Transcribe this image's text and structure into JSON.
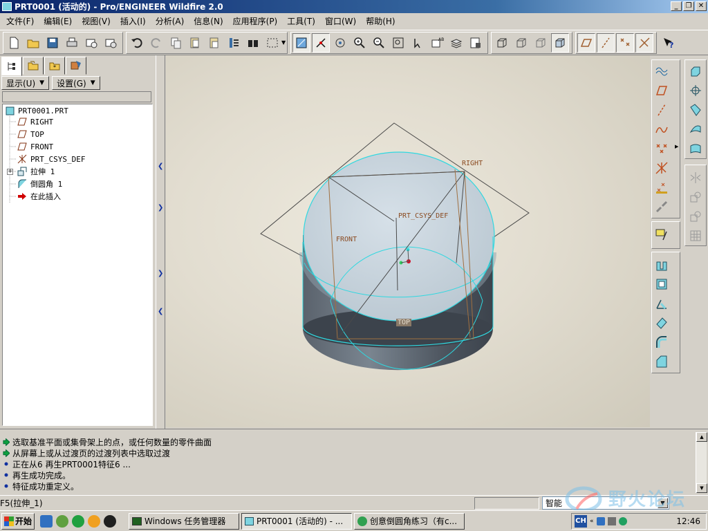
{
  "window": {
    "title": "PRT0001 (活动的) - Pro/ENGINEER Wildfire 2.0"
  },
  "menu": [
    "文件(F)",
    "编辑(E)",
    "视图(V)",
    "插入(I)",
    "分析(A)",
    "信息(N)",
    "应用程序(P)",
    "工具(T)",
    "窗口(W)",
    "帮助(H)"
  ],
  "left_panel": {
    "show_label": "显示(U)",
    "settings_label": "设置(G)"
  },
  "model_tree": {
    "root": "PRT0001.PRT",
    "items": [
      {
        "label": "RIGHT",
        "icon": "datum-plane-icon"
      },
      {
        "label": "TOP",
        "icon": "datum-plane-icon"
      },
      {
        "label": "FRONT",
        "icon": "datum-plane-icon"
      },
      {
        "label": "PRT_CSYS_DEF",
        "icon": "csys-icon"
      },
      {
        "label": "拉伸 1",
        "icon": "extrude-icon"
      },
      {
        "label": "倒圆角 1",
        "icon": "round-icon"
      },
      {
        "label": "在此插入",
        "icon": "insert-here-arrow-icon"
      }
    ]
  },
  "viewport": {
    "labels": {
      "right": "RIGHT",
      "front": "FRONT",
      "csys": "PRT_CSYS_DEF",
      "top": "TOP"
    },
    "csys_prefix": "CS",
    "colors": {
      "surface_top": "#c8d4dc",
      "edge_highlight": "#2fd8e0",
      "datum_plane": "#a07040",
      "datum_line": "#404040"
    }
  },
  "messages": [
    {
      "type": "prompt",
      "text": "选取基准平面或集骨架上的点，或任何数量的零件曲面"
    },
    {
      "type": "prompt",
      "text": "从屏幕上或从过渡页的过渡列表中选取过渡"
    },
    {
      "type": "info",
      "text": "正在从6 再生PRT0001特征6 ..."
    },
    {
      "type": "info",
      "text": "再生成功完成。"
    },
    {
      "type": "info",
      "text": "特征成功重定义。"
    }
  ],
  "status": {
    "feature": "F5(拉伸_1)",
    "filter": "智能"
  },
  "watermark": {
    "text": "野火论坛"
  },
  "taskbar": {
    "start": "开始",
    "tasks": [
      {
        "label": "Windows 任务管理器",
        "active": false
      },
      {
        "label": "PRT0001 (活动的) - ...",
        "active": true
      },
      {
        "label": "创意倒圆角练习（有c...",
        "active": false
      }
    ],
    "ime": "CH",
    "clock": "12:46"
  }
}
